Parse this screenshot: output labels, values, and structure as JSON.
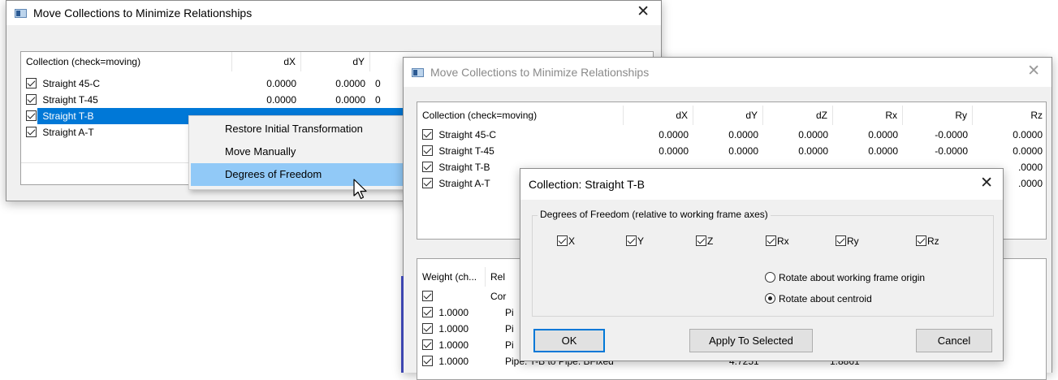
{
  "window_back": {
    "title": "Move Collections to Minimize Relationships",
    "close_glyph": "✕",
    "columns": [
      "Collection (check=moving)",
      "dX",
      "dY"
    ],
    "rows": [
      {
        "name": "Straight 45-C",
        "dX": "0.0000",
        "dY": "0.0000",
        "clip": "0"
      },
      {
        "name": "Straight T-45",
        "dX": "0.0000",
        "dY": "0.0000",
        "clip": "0"
      },
      {
        "name": "Straight T-B"
      },
      {
        "name": "Straight A-T"
      }
    ]
  },
  "context_menu": {
    "items": [
      "Restore Initial Transformation",
      "Move Manually",
      "Degrees of Freedom"
    ]
  },
  "window_front": {
    "title": "Move Collections to Minimize Relationships",
    "close_glyph": "✕",
    "columns": [
      "Collection (check=moving)",
      "dX",
      "dY",
      "dZ",
      "Rx",
      "Ry",
      "Rz"
    ],
    "rows": [
      {
        "name": "Straight 45-C",
        "dX": "0.0000",
        "dY": "0.0000",
        "dZ": "0.0000",
        "Rx": "0.0000",
        "Ry": "-0.0000",
        "Rz": "0.0000"
      },
      {
        "name": "Straight T-45",
        "dX": "0.0000",
        "dY": "0.0000",
        "dZ": "0.0000",
        "Rx": "0.0000",
        "Ry": "-0.0000",
        "Rz": "0.0000"
      },
      {
        "name": "Straight T-B",
        "Rz": ".0000"
      },
      {
        "name": "Straight A-T",
        "Rz": ".0000"
      }
    ],
    "relationships": {
      "columns": [
        "Weight (ch...",
        "Rel"
      ],
      "rows": [
        {
          "weight": "",
          "rel": "Cor"
        },
        {
          "weight": "1.0000",
          "rel": "Pi"
        },
        {
          "weight": "1.0000",
          "rel": "Pi"
        },
        {
          "weight": "1.0000",
          "rel": "Pi"
        },
        {
          "weight": "1.0000",
          "rel": "Pipe: T-B to Pipe: BFixed",
          "v1": "4.7251",
          "v2": "1.8861"
        }
      ]
    }
  },
  "dof_dialog": {
    "title": "Collection: Straight T-B",
    "close_glyph": "✕",
    "group_label": "Degrees of Freedom (relative to working frame axes)",
    "axes": [
      "X",
      "Y",
      "Z",
      "Rx",
      "Ry",
      "Rz"
    ],
    "radio_options": [
      "Rotate about working frame origin",
      "Rotate about centroid"
    ],
    "selected_radio": 1,
    "buttons": {
      "ok": "OK",
      "apply": "Apply To Selected",
      "cancel": "Cancel"
    }
  }
}
